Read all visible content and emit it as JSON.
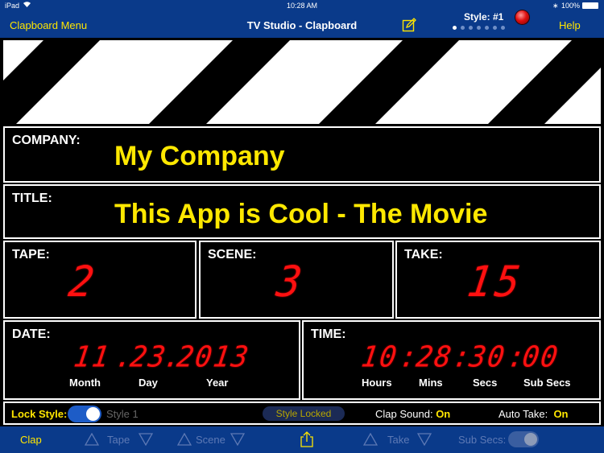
{
  "status_bar": {
    "device": "iPad",
    "time": "10:28 AM",
    "battery": "100%"
  },
  "nav": {
    "left": "Clapboard Menu",
    "title": "TV Studio - Clapboard",
    "style": "Style: #1",
    "help": "Help",
    "page_dots": 7,
    "active_dot": 0
  },
  "company": {
    "label": "COMPANY:",
    "value": "My Company"
  },
  "title": {
    "label": "TITLE:",
    "value": "This App is Cool - The Movie"
  },
  "tape": {
    "label": "TAPE:",
    "value": "2"
  },
  "scene": {
    "label": "SCENE:",
    "value": "3"
  },
  "take": {
    "label": "TAKE:",
    "value": "15"
  },
  "date": {
    "label": "DATE:",
    "month": "11",
    "day": "23",
    "year": "2013",
    "sep": ".",
    "month_label": "Month",
    "day_label": "Day",
    "year_label": "Year"
  },
  "time": {
    "label": "TIME:",
    "hours": "10",
    "mins": "28",
    "secs": "30",
    "subsecs": "00",
    "sep": ":",
    "hours_label": "Hours",
    "mins_label": "Mins",
    "secs_label": "Secs",
    "subsecs_label": "Sub Secs"
  },
  "options": {
    "lock_style_label": "Lock Style:",
    "lock_style_on": true,
    "style_name": "Style 1",
    "style_locked": "Style Locked",
    "clap_sound_label": "Clap Sound:",
    "clap_sound_value": "On",
    "auto_take_label": "Auto Take:",
    "auto_take_value": "On"
  },
  "toolbar": {
    "clap": "Clap",
    "tape": "Tape",
    "scene": "Scene",
    "take": "Take",
    "sub_secs": "Sub Secs:"
  },
  "colors": {
    "bar": "#0a3a8a",
    "accent": "#ffe600",
    "led": "#ff1010"
  }
}
